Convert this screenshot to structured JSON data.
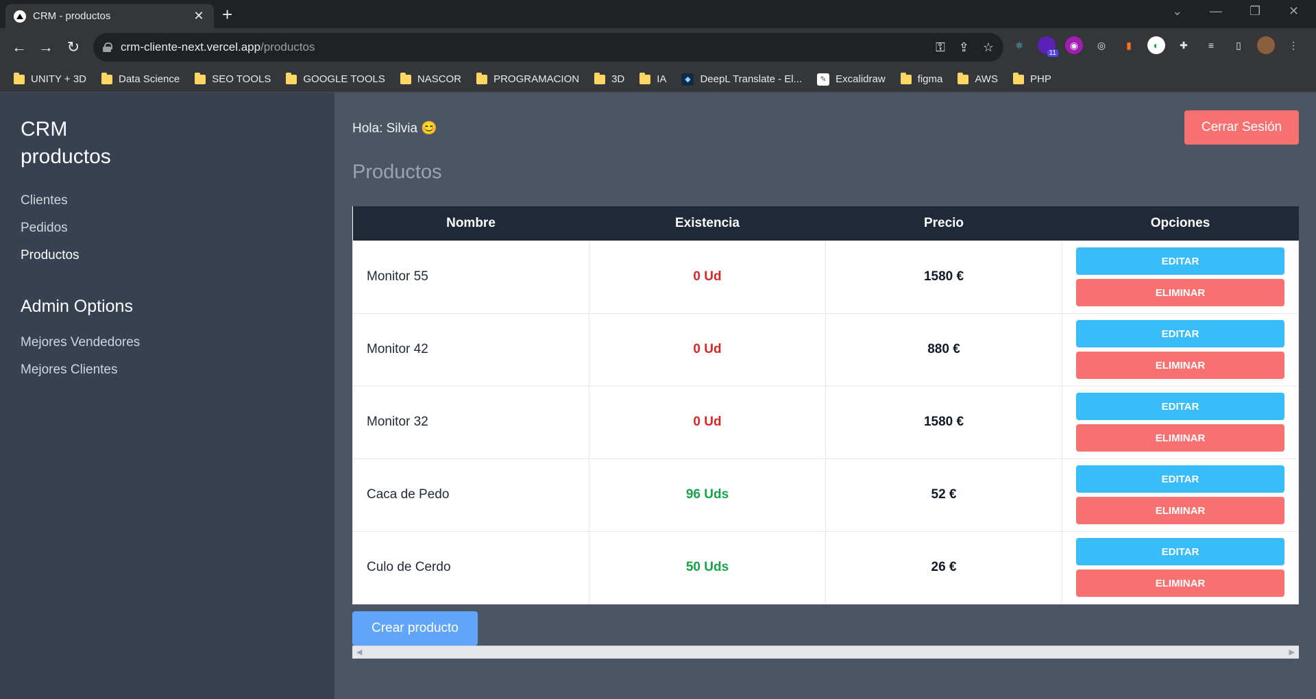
{
  "browser": {
    "tab_title": "CRM - productos",
    "url_host": "crm-cliente-next.vercel.app",
    "url_path": "/productos",
    "bookmarks": [
      "UNITY + 3D",
      "Data Science",
      "SEO TOOLS",
      "GOOGLE TOOLS",
      "NASCOR",
      "PROGRAMACION",
      "3D",
      "IA",
      "DeepL Translate - El...",
      "Excalidraw",
      "figma",
      "AWS",
      "PHP"
    ],
    "extension_badge": "11"
  },
  "sidebar": {
    "brand": "CRM productos",
    "nav": [
      "Clientes",
      "Pedidos",
      "Productos"
    ],
    "admin_title": "Admin Options",
    "admin_nav": [
      "Mejores Vendedores",
      "Mejores Clientes"
    ]
  },
  "header": {
    "greeting": "Hola: Silvia 😊",
    "logout_label": "Cerrar Sesión"
  },
  "page_title": "Productos",
  "table": {
    "headers": [
      "Nombre",
      "Existencia",
      "Precio",
      "Opciones"
    ],
    "rows": [
      {
        "name": "Monitor 55",
        "stock": "0 Ud",
        "price": "1580 €"
      },
      {
        "name": "Monitor 42",
        "stock": "0 Ud",
        "price": "880 €"
      },
      {
        "name": "Monitor 32",
        "stock": "0 Ud",
        "price": "1580 €"
      },
      {
        "name": "Caca de Pedo",
        "stock": "96 Uds",
        "price": "52 €"
      },
      {
        "name": "Culo de Cerdo",
        "stock": "50 Uds",
        "price": "26 €"
      }
    ],
    "edit_label": "EDITAR",
    "delete_label": "ELIMINAR"
  },
  "create_label": "Crear producto",
  "colors": {
    "sidebar": "#374151",
    "main": "#4b5563",
    "logout": "#f87171",
    "edit": "#38bdf8",
    "delete": "#f87171",
    "create": "#60a5fa",
    "stock_out": "#dc2626",
    "stock_in": "#16a34a"
  }
}
